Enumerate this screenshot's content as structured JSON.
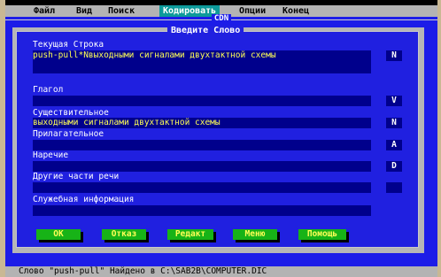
{
  "menu": {
    "items": [
      {
        "label": "Файл"
      },
      {
        "label": "Вид"
      },
      {
        "label": "Поиск"
      },
      {
        "label": "Кодировать",
        "active": true
      },
      {
        "label": "Опции"
      },
      {
        "label": "Конец"
      }
    ]
  },
  "window": {
    "title": "CDN"
  },
  "dialog": {
    "title": "Введите Слово",
    "fields": {
      "current_line": {
        "label": "Текущая Строка",
        "value": "push-pull*Nвыходными сигналами двухтактной схемы",
        "button": "N"
      },
      "verb": {
        "label": "Глагол",
        "value": "",
        "button": "V"
      },
      "noun": {
        "label": "Существительное",
        "value": "выходными сигналами двухтактной схемы",
        "button": "N"
      },
      "adjective": {
        "label": "Прилагательное",
        "value": "",
        "button": "A"
      },
      "adverb": {
        "label": "Наречие",
        "value": "",
        "button": "D"
      },
      "other": {
        "label": "Другие части речи",
        "value": "",
        "button": ""
      },
      "service": {
        "label": "Служебная информация",
        "value": ""
      }
    },
    "buttons": {
      "ok": "OK",
      "cancel": "Отказ",
      "edit": "Редакт",
      "menu": "Меню",
      "help": "Помощь"
    }
  },
  "status": {
    "text": "Слово \"push-pull\" Найдено в C:\\SAB2B\\COMPUTER.DIC"
  },
  "colors": {
    "screen_bg": "#1c1ce8",
    "field_bg": "#00008c",
    "field_text": "#ffff55",
    "button_bg": "#17b317",
    "menu_active": "#0d9a9a",
    "menu_bg": "#b3b3b3"
  }
}
